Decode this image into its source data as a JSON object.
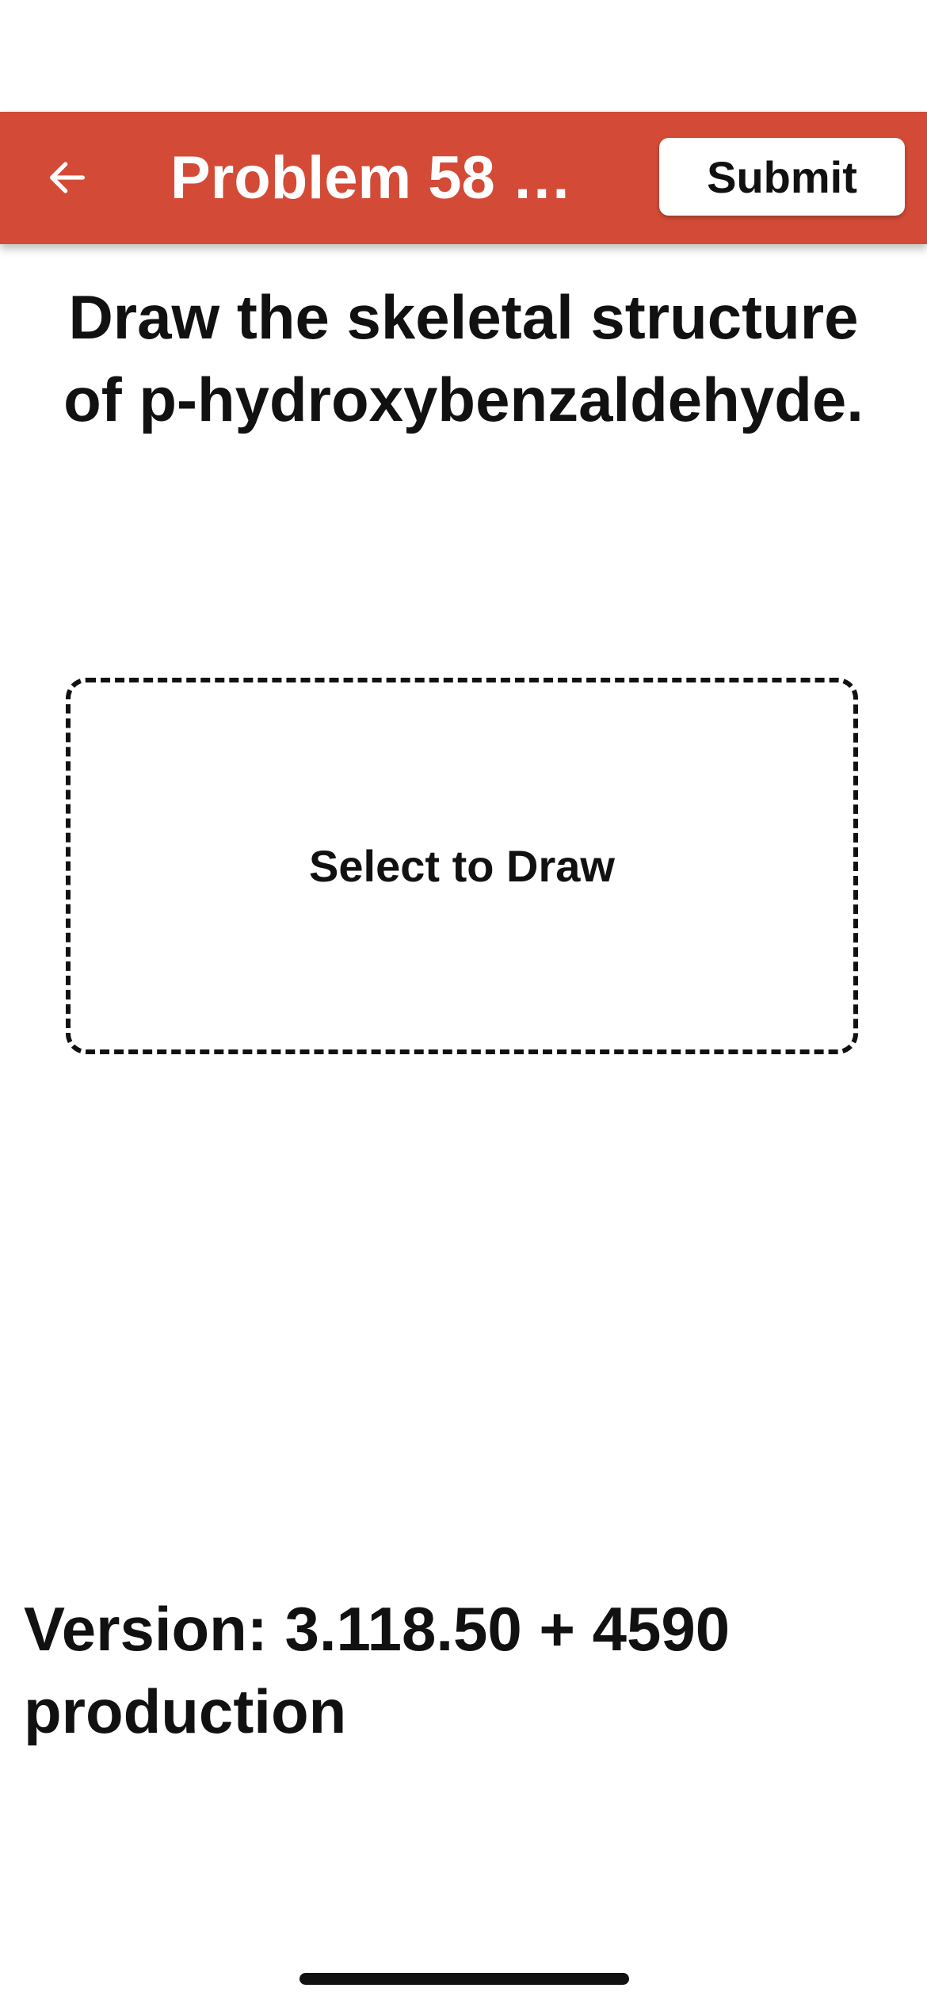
{
  "header": {
    "back_icon": "arrow-left-icon",
    "title": "Problem 58 …",
    "submit_label": "Submit",
    "background_color": "#d34b37"
  },
  "question": {
    "text": "Draw the skeletal structure of p-hydroxybenzaldehyde."
  },
  "draw_area": {
    "label": "Select to Draw"
  },
  "footer": {
    "version_text": "Version: 3.118.50 + 4590 production"
  }
}
